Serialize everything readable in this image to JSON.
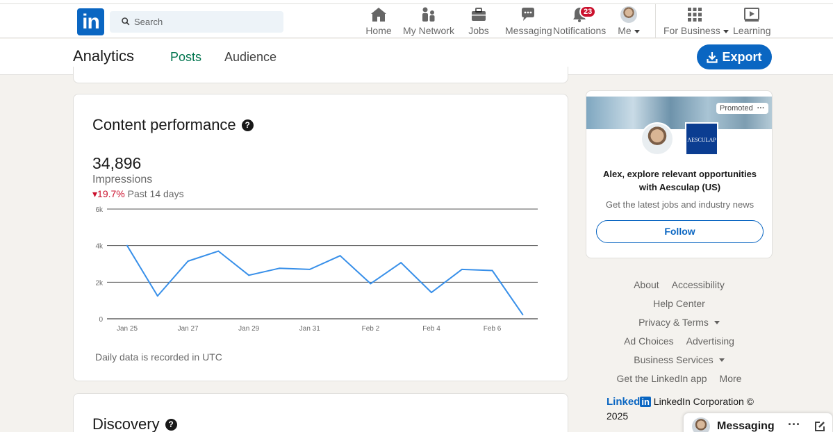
{
  "nav": {
    "logo": "in",
    "search_placeholder": "Search",
    "items": [
      {
        "label": "Home",
        "icon": "home-icon"
      },
      {
        "label": "My Network",
        "icon": "network-icon"
      },
      {
        "label": "Jobs",
        "icon": "jobs-icon"
      },
      {
        "label": "Messaging",
        "icon": "messaging-icon"
      },
      {
        "label": "Notifications",
        "icon": "bell-icon",
        "badge": "23"
      },
      {
        "label": "Me",
        "icon": "avatar"
      },
      {
        "label": "For Business",
        "icon": "grid-icon"
      },
      {
        "label": "Learning",
        "icon": "learning-icon"
      }
    ]
  },
  "subheader": {
    "title": "Analytics",
    "tabs": [
      "Posts",
      "Audience"
    ],
    "active_tab": "Posts",
    "export_label": "Export"
  },
  "performance": {
    "title": "Content performance",
    "value": "34,896",
    "metric": "Impressions",
    "change": "19.7%",
    "change_direction": "down",
    "period": "Past 14 days",
    "footnote": "Daily data is recorded in UTC"
  },
  "chart_data": {
    "type": "line",
    "x": [
      "Jan 25",
      "Jan 26",
      "Jan 27",
      "Jan 28",
      "Jan 29",
      "Jan 30",
      "Jan 31",
      "Feb 1",
      "Feb 2",
      "Feb 3",
      "Feb 4",
      "Feb 5",
      "Feb 6",
      "Feb 7"
    ],
    "x_tick_labels": [
      "Jan 25",
      "Jan 27",
      "Jan 29",
      "Jan 31",
      "Feb 2",
      "Feb 4",
      "Feb 6"
    ],
    "series": [
      {
        "values": [
          4000,
          1250,
          3150,
          3700,
          2380,
          2760,
          2700,
          3450,
          1920,
          3070,
          1440,
          2700,
          2640,
          230
        ]
      }
    ],
    "y_ticks": [
      "0",
      "2k",
      "4k",
      "6k"
    ],
    "ylim": [
      0,
      6000
    ],
    "grid": true,
    "color": "#378fe9"
  },
  "discovery": {
    "title": "Discovery"
  },
  "ad": {
    "promoted_label": "Promoted",
    "logo_text": "AESCULAP",
    "headline": "Alex, explore relevant opportunities with Aesculap (US)",
    "subtext": "Get the latest jobs and industry news",
    "follow_label": "Follow"
  },
  "footer": {
    "rows": [
      [
        "About",
        "Accessibility"
      ],
      [
        "Help Center"
      ],
      [
        "Privacy & Terms"
      ],
      [
        "Ad Choices",
        "Advertising"
      ],
      [
        "Business Services"
      ],
      [
        "Get the LinkedIn app",
        "More"
      ]
    ],
    "brand_text": "Linked",
    "brand_box": "in",
    "corp": "LinkedIn Corporation © 2025"
  },
  "messaging": {
    "label": "Messaging",
    "more": "···"
  },
  "colors": {
    "brand": "#0a66c2",
    "active_tab": "#01754f",
    "badge": "#cb112d"
  }
}
